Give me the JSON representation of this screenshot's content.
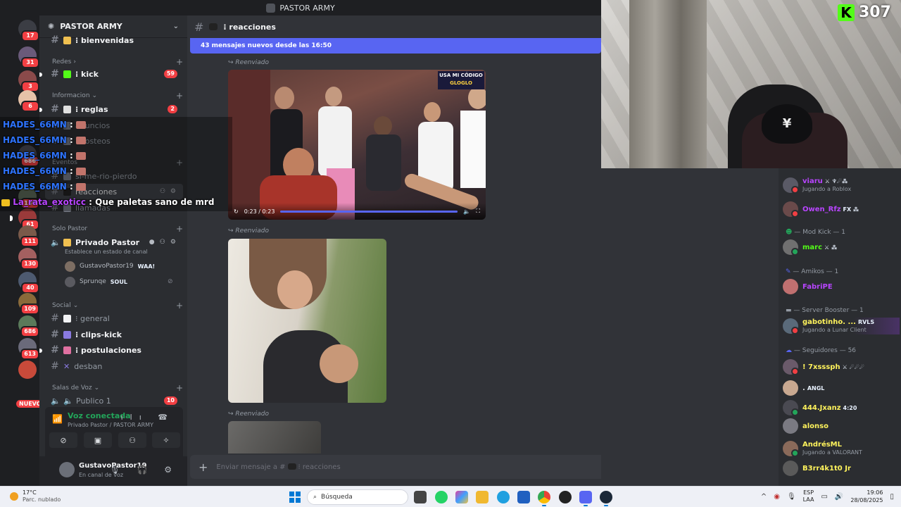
{
  "window": {
    "title": "PASTOR ARMY"
  },
  "rail": {
    "badges": [
      "17",
      "31",
      "3",
      "6",
      "686",
      "180",
      "61",
      "111",
      "130",
      "40",
      "109",
      "686",
      "613",
      "416"
    ],
    "new_label": "NUEVO",
    "bottom_badge": "416"
  },
  "server": {
    "name": "PASTOR ARMY"
  },
  "sidebar": {
    "cat_redes": "Redes",
    "cat_info": "Informacion",
    "cat_eventos": "Eventos",
    "cat_solo": "Solo Pastor",
    "cat_social": "Social",
    "cat_voz": "Salas de Voz",
    "channels": {
      "bienvenidas": "⁝ bienvenidas",
      "kick": "⁝ kick",
      "kick_count": "59",
      "reglas": "⁝ reglas",
      "reglas_count": "2",
      "anuncios": "anuncios",
      "boosteos": "boosteos",
      "si_me_rio": "si-me-rio-pierdo",
      "reacciones": "reacciones",
      "llamadas": "llamadas",
      "privado": "Privado Pastor",
      "privado_status": "Establece un estado de canal",
      "general": "⁝ general",
      "clips": "⁝ clips-kick",
      "postulaciones": "⁝ postulaciones",
      "desban": "desban",
      "publico": "Publico 1",
      "publico_count": "10"
    },
    "voice_users": [
      {
        "name": "GustavoPastor19",
        "tag": "WAA!"
      },
      {
        "name": "Sprunqe",
        "tag": "SOUL"
      }
    ]
  },
  "voice_panel": {
    "status": "Voz conectada",
    "sub": "Privado Pastor / PASTOR ARMY"
  },
  "user": {
    "name": "GustavoPastor19",
    "status": "En canal de voz"
  },
  "chat": {
    "channel": "⁝ reacciones",
    "new_messages": "43 mensajes nuevos desde las 16:50",
    "forwarded": "Reenviado",
    "video": {
      "time": "0:23 / 0:23",
      "promo_line1": "USA MI CÓDIGO",
      "promo_line2": "GLOGLO",
      "progress": 1.0
    },
    "composer_placeholder": "Enviar mensaje a #",
    "composer_channel": "⁝ reacciones"
  },
  "stream": {
    "viewers": "307"
  },
  "overlay_chat": [
    {
      "user": "HADES_66MN",
      "text": ""
    },
    {
      "user": "HADES_66MN",
      "text": ""
    },
    {
      "user": "HADES_66MN",
      "text": ""
    },
    {
      "user": "HADES_66MN",
      "text": ""
    },
    {
      "user": "HADES_66MN",
      "text": ""
    },
    {
      "user": "La_rata_exoticc",
      "text": "Que paletas sano de mrd"
    }
  ],
  "members": {
    "top": [
      {
        "name": "viaru",
        "tag": "⚔ ♆☄⁂",
        "activity": "Jugando a Roblox",
        "color": "#b845ff"
      },
      {
        "name": "Owen_Rfz",
        "tag": "FX ⁂",
        "activity": "",
        "color": "#b845ff"
      }
    ],
    "role_mod": "— Mod Kick — 1",
    "mod": {
      "name": "marc",
      "tag": "⚔ ⁂",
      "color": "#53fc18"
    },
    "role_amikos": "— Amikos — 1",
    "amikos": {
      "name": "FabriPE",
      "color": "#b845ff"
    },
    "role_booster": "— Server Booster — 1",
    "booster": {
      "name": "gabotinho. ...",
      "tag": "RVLS",
      "activity": "Jugando a Lunar Client",
      "color": "#fff35c"
    },
    "role_seg": "— Seguidores — 56",
    "seg": [
      {
        "name": "! 7xsssph",
        "tag": "⚔ ☄☄☄",
        "activity": "",
        "color": "#fff35c"
      },
      {
        "name": ".",
        "tag": "ANGL",
        "activity": "",
        "color": "#dbdee1"
      },
      {
        "name": "444.Jxanz",
        "tag": "4:20",
        "activity": "",
        "color": "#fff35c"
      },
      {
        "name": "alonso",
        "tag": "",
        "activity": "",
        "color": "#fff35c"
      },
      {
        "name": "AndrésML",
        "tag": "",
        "activity": "Jugando a VALORANT",
        "color": "#fff35c"
      },
      {
        "name": "B3rr4k1t0 Jr",
        "tag": "",
        "activity": "",
        "color": "#fff35c"
      }
    ]
  },
  "taskbar": {
    "temp": "17°C",
    "weather": "Parc. nublado",
    "search": "Búsqueda",
    "lang1": "ESP",
    "lang2": "LAA",
    "time": "19:06",
    "date": "28/08/2025"
  }
}
